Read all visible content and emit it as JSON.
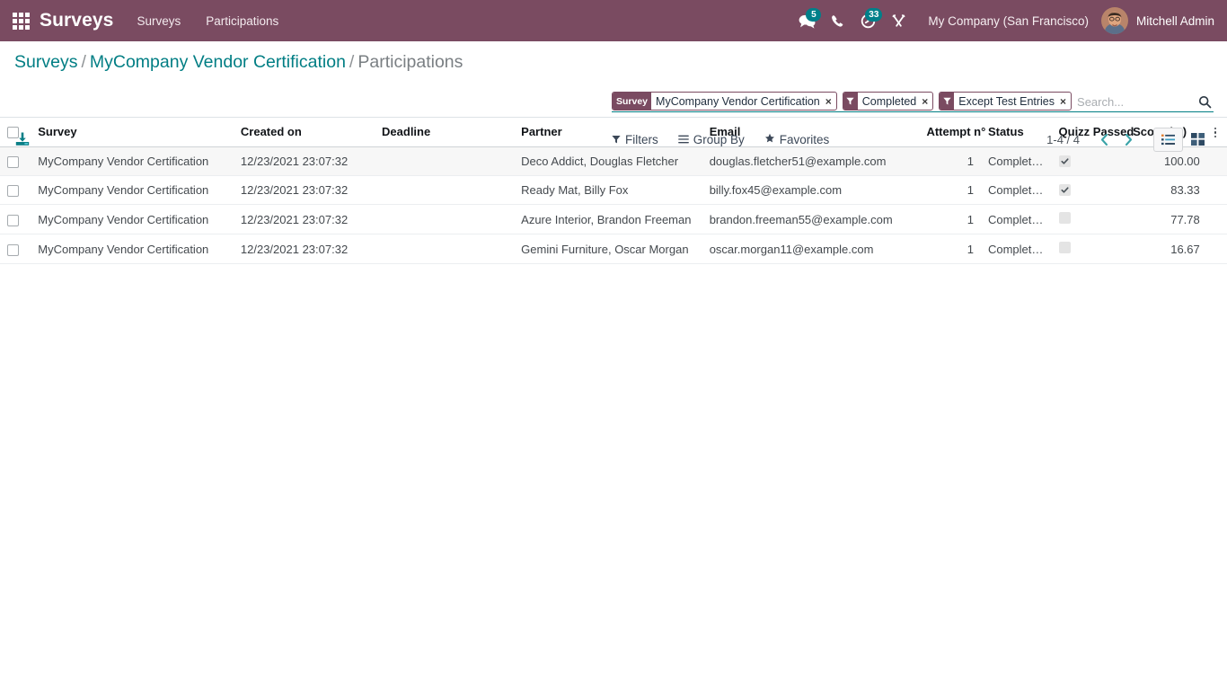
{
  "navbar": {
    "apps_icon": "apps-grid-icon",
    "brand": "Surveys",
    "menu": [
      {
        "label": "Surveys"
      },
      {
        "label": "Participations"
      }
    ],
    "systray": [
      {
        "icon": "messages-icon",
        "badge": "5"
      },
      {
        "icon": "phone-icon",
        "badge": ""
      },
      {
        "icon": "activities-clock-icon",
        "badge": "33"
      },
      {
        "icon": "wrench-tools-icon",
        "badge": ""
      }
    ],
    "company": "My Company (San Francisco)",
    "user": "Mitchell Admin",
    "bg_color": "#7a4b61",
    "badge_color": "#00808a"
  },
  "breadcrumb": {
    "root": "Surveys",
    "parent": "MyCompany Vendor Certification",
    "current": "Participations",
    "separator": "/",
    "link_color": "#017e84"
  },
  "search": {
    "placeholder": "Search...",
    "value": "",
    "search_icon": "magnifier-icon",
    "facets": [
      {
        "label": "Survey",
        "icon": "",
        "value": "MyCompany Vendor Certification",
        "remove": "×"
      },
      {
        "label": "",
        "icon": "filter-funnel-icon",
        "value": "Completed",
        "remove": "×"
      },
      {
        "label": "",
        "icon": "filter-funnel-icon",
        "value": "Except Test Entries",
        "remove": "×"
      }
    ]
  },
  "toolbar": {
    "download_icon": "download-export-icon",
    "filters": {
      "label": "Filters",
      "icon": "funnel-icon"
    },
    "group_by": {
      "label": "Group By",
      "icon": "list-lines-icon"
    },
    "favorites": {
      "label": "Favorites",
      "icon": "star-icon"
    },
    "pager": {
      "range": "1-4 / 4",
      "prev_icon": "chevron-left-icon",
      "next_icon": "chevron-right-icon"
    },
    "views": [
      {
        "name": "list",
        "icon": "list-view-icon",
        "active": true
      },
      {
        "name": "kanban",
        "icon": "kanban-view-icon",
        "active": false
      }
    ]
  },
  "table": {
    "columns": [
      "Survey",
      "Created on",
      "Deadline",
      "Partner",
      "Email",
      "Attempt n°",
      "Status",
      "Quizz Passed",
      "Score (%)"
    ],
    "rows": [
      {
        "survey": "MyCompany Vendor Certification",
        "created_on": "12/23/2021 23:07:32",
        "deadline": "",
        "partner": "Deco Addict, Douglas Fletcher",
        "email": "douglas.fletcher51@example.com",
        "attempt": "1",
        "status": "Completed",
        "quizz_passed": true,
        "score": "100.00",
        "highlighted": true
      },
      {
        "survey": "MyCompany Vendor Certification",
        "created_on": "12/23/2021 23:07:32",
        "deadline": "",
        "partner": "Ready Mat, Billy Fox",
        "email": "billy.fox45@example.com",
        "attempt": "1",
        "status": "Completed",
        "quizz_passed": true,
        "score": "83.33",
        "highlighted": false
      },
      {
        "survey": "MyCompany Vendor Certification",
        "created_on": "12/23/2021 23:07:32",
        "deadline": "",
        "partner": "Azure Interior, Brandon Freeman",
        "email": "brandon.freeman55@example.com",
        "attempt": "1",
        "status": "Completed",
        "quizz_passed": false,
        "score": "77.78",
        "highlighted": false
      },
      {
        "survey": "MyCompany Vendor Certification",
        "created_on": "12/23/2021 23:07:32",
        "deadline": "",
        "partner": "Gemini Furniture, Oscar Morgan",
        "email": "oscar.morgan11@example.com",
        "attempt": "1",
        "status": "Completed",
        "quizz_passed": false,
        "score": "16.67",
        "highlighted": false
      }
    ],
    "optional_columns_icon": "vertical-dots-icon"
  }
}
